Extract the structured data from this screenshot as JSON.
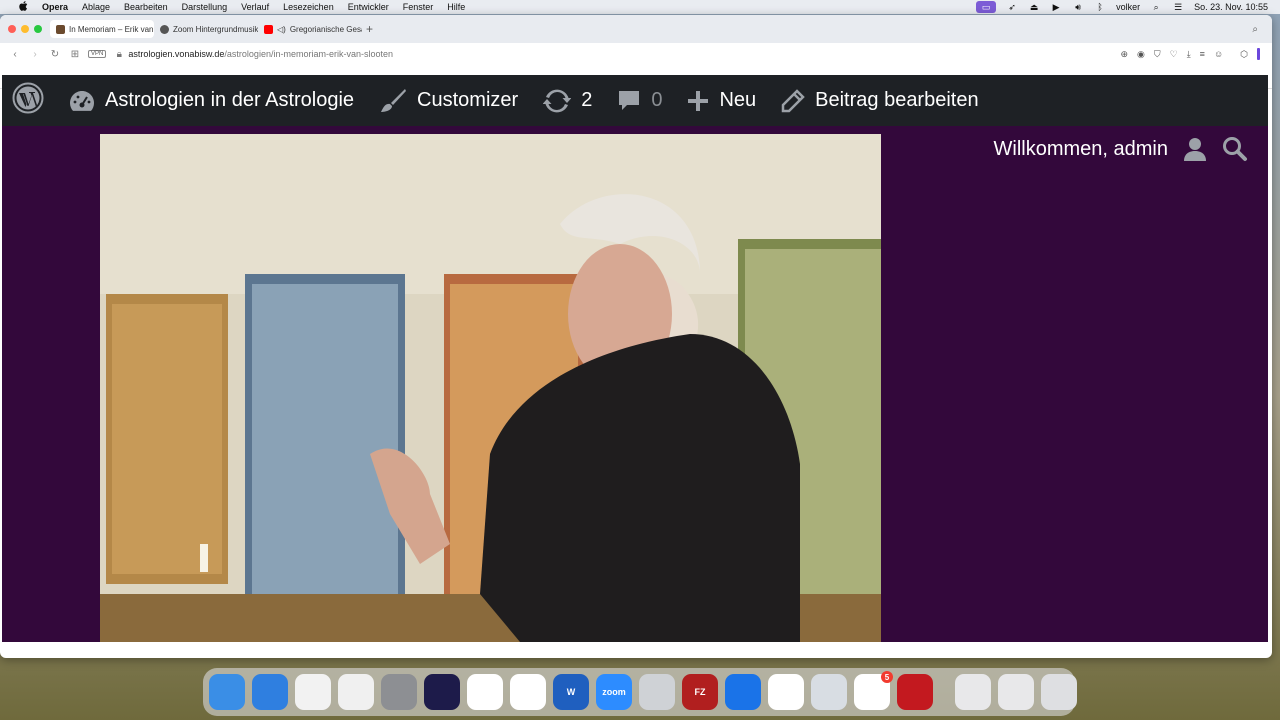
{
  "menubar": {
    "apple": "",
    "app": "Opera",
    "items": [
      "Ablage",
      "Bearbeiten",
      "Darstellung",
      "Verlauf",
      "Lesezeichen",
      "Entwickler",
      "Fenster",
      "Hilfe"
    ],
    "user": "volker",
    "datetime": "So. 23. Nov.  10:55"
  },
  "tabs": [
    {
      "label": "In Memoriam – Erik van",
      "active": true,
      "color": "#6b4a2e"
    },
    {
      "label": "Zoom Hintergrundmusik",
      "active": false,
      "color": "#555555"
    },
    {
      "label": "Gregorianische Gesä",
      "active": false,
      "color": "#ff0000"
    }
  ],
  "address": {
    "vpn": "VPN",
    "url_domain": "astrologien.vonabisw.de",
    "url_path": "/astrologien/in-memoriam-erik-van-slooten"
  },
  "wpbar": {
    "site_name": "Astrologien in der Astrologie",
    "customizer": "Customizer",
    "updates": "2",
    "comments": "0",
    "new": "Neu",
    "edit": "Beitrag bearbeiten"
  },
  "page": {
    "welcome": "Willkommen, admin"
  },
  "dock": {
    "apps": [
      {
        "name": "finder",
        "label": "",
        "color": "#3a8ee6"
      },
      {
        "name": "safari",
        "label": "",
        "color": "#2f7fe0"
      },
      {
        "name": "chrome",
        "label": "",
        "color": "#f2f2f2"
      },
      {
        "name": "affinity",
        "label": "",
        "color": "#f0f0f0"
      },
      {
        "name": "system-settings",
        "label": "",
        "color": "#8d8f93"
      },
      {
        "name": "firefox",
        "label": "",
        "color": "#1d1b4a"
      },
      {
        "name": "opera",
        "label": "",
        "color": "#ffffff"
      },
      {
        "name": "vlc",
        "label": "",
        "color": "#ffffff"
      },
      {
        "name": "word",
        "label": "W",
        "color": "#1f5fbf"
      },
      {
        "name": "zoom",
        "label": "zoom",
        "color": "#2d8cff"
      },
      {
        "name": "printer",
        "label": "",
        "color": "#cfd2d6"
      },
      {
        "name": "filezilla",
        "label": "FZ",
        "color": "#b11f1f"
      },
      {
        "name": "teamviewer",
        "label": "",
        "color": "#1a73e8"
      },
      {
        "name": "photos",
        "label": "",
        "color": "#ffffff"
      },
      {
        "name": "preview",
        "label": "",
        "color": "#d8dde3"
      },
      {
        "name": "microsoft",
        "label": "",
        "color": "#ffffff",
        "badge": "5"
      },
      {
        "name": "acrobat",
        "label": "",
        "color": "#c3191f"
      }
    ],
    "minimized": [
      {
        "name": "window-thumb-1",
        "color": "#e8e8ea"
      },
      {
        "name": "window-thumb-2",
        "color": "#e8e8ea"
      },
      {
        "name": "trash",
        "color": "#dedfe2"
      }
    ]
  }
}
